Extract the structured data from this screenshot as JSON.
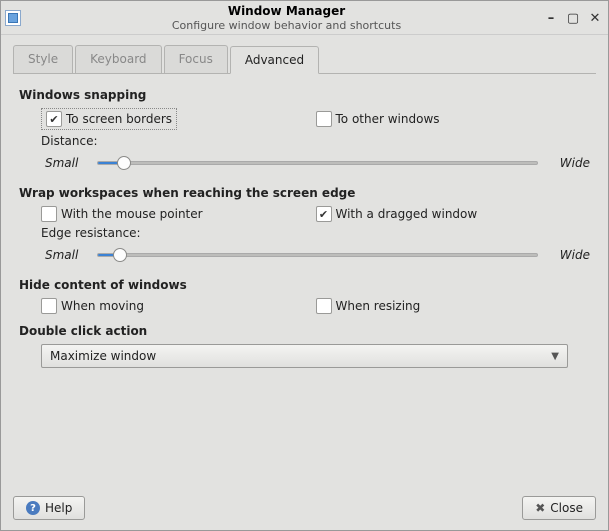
{
  "window": {
    "title": "Window Manager",
    "subtitle": "Configure window behavior and shortcuts"
  },
  "tabs": {
    "style": "Style",
    "keyboard": "Keyboard",
    "focus": "Focus",
    "advanced": "Advanced"
  },
  "sections": {
    "snapping": {
      "title": "Windows snapping",
      "to_screen": "To screen borders",
      "to_other": "To other windows",
      "distance": "Distance:",
      "min": "Small",
      "max": "Wide"
    },
    "wrap": {
      "title": "Wrap workspaces when reaching the screen edge",
      "mouse": "With the mouse pointer",
      "dragged": "With a dragged window",
      "resistance": "Edge resistance:",
      "min": "Small",
      "max": "Wide"
    },
    "hide": {
      "title": "Hide content of windows",
      "moving": "When moving",
      "resizing": "When resizing"
    },
    "dblclick": {
      "title": "Double click action",
      "selected": "Maximize window"
    }
  },
  "state": {
    "snap_screen": true,
    "snap_other": false,
    "snap_slider_pct": 6,
    "wrap_mouse": false,
    "wrap_dragged": true,
    "wrap_slider_pct": 5,
    "hide_moving": false,
    "hide_resizing": false
  },
  "buttons": {
    "help": "Help",
    "close": "Close"
  }
}
